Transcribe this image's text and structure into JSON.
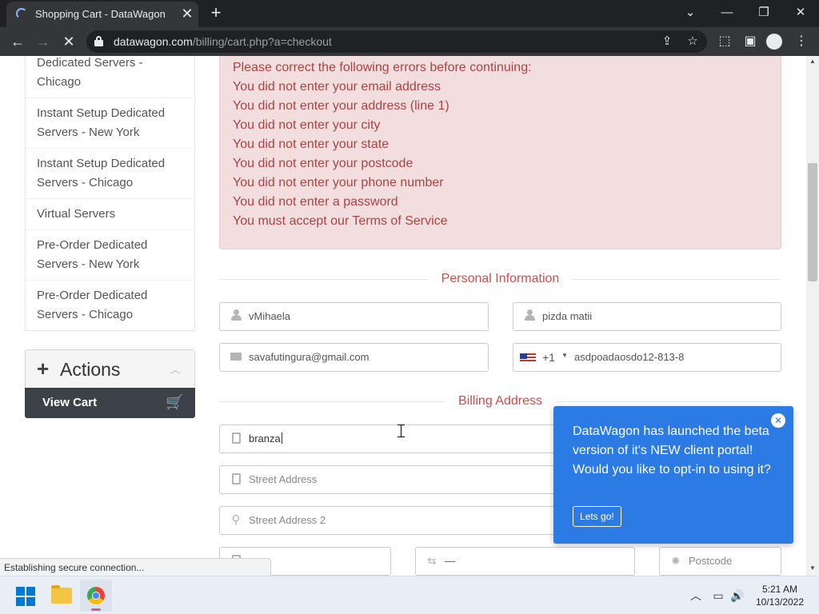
{
  "browser": {
    "tab_title": "Shopping Cart - DataWagon",
    "url_host": "datawagon.com",
    "url_path": "/billing/cart.php?a=checkout",
    "status": "Establishing secure connection..."
  },
  "sidebar": {
    "items": [
      {
        "label": "Dedicated Servers - Chicago"
      },
      {
        "label": "Instant Setup Dedicated Servers - New York"
      },
      {
        "label": "Instant Setup Dedicated Servers - Chicago"
      },
      {
        "label": "Virtual Servers"
      },
      {
        "label": "Pre-Order Dedicated Servers - New York"
      },
      {
        "label": "Pre-Order Dedicated Servers - Chicago"
      }
    ],
    "actions_title": "Actions",
    "view_cart_label": "View Cart"
  },
  "alert": {
    "lines": [
      "Please correct the following errors before continuing:",
      "You did not enter your email address",
      "You did not enter your address (line 1)",
      "You did not enter your city",
      "You did not enter your state",
      "You did not enter your postcode",
      "You did not enter your phone number",
      "You did not enter a password",
      "You must accept our Terms of Service"
    ],
    "color": "#a94442"
  },
  "personal": {
    "heading": "Personal Information",
    "first_name": "vMihaela",
    "last_name": "pizda matii",
    "email": "savafutingura@gmail.com",
    "phone_code": "+1",
    "phone": "asdpoadaosdo12-813-8"
  },
  "billing": {
    "heading": "Billing Address",
    "company": "branza",
    "street_placeholder": "Street Address",
    "street2_placeholder": "Street Address 2",
    "state_value": "—",
    "postcode_placeholder": "Postcode"
  },
  "popup": {
    "message": "DataWagon has launched the beta version of it's NEW client portal! Would you like to opt-in to using it?",
    "button": "Lets go!",
    "color": "#2c7be5"
  },
  "taskbar": {
    "time": "5:21 AM",
    "date": "10/13/2022"
  },
  "accent_color": "#cc4d4d"
}
